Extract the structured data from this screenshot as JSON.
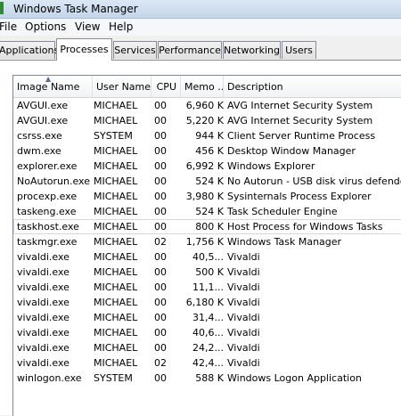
{
  "window": {
    "title": "Windows Task Manager"
  },
  "menu": [
    "File",
    "Options",
    "View",
    "Help"
  ],
  "tabs": [
    "Applications",
    "Processes",
    "Services",
    "Performance",
    "Networking",
    "Users"
  ],
  "active_tab": "Processes",
  "columns": {
    "name": "Image Name",
    "user": "User Name",
    "cpu": "CPU",
    "mem": "Memo ...",
    "desc": "Description",
    "sort_indicator": "▲"
  },
  "processes": [
    {
      "name": "AVGUI.exe",
      "user": "MICHAEL",
      "cpu": "00",
      "mem": "6,960 K",
      "desc": "AVG Internet Security System"
    },
    {
      "name": "AVGUI.exe",
      "user": "MICHAEL",
      "cpu": "00",
      "mem": "5,220 K",
      "desc": "AVG Internet Security System"
    },
    {
      "name": "csrss.exe",
      "user": "SYSTEM",
      "cpu": "00",
      "mem": "944 K",
      "desc": "Client Server Runtime Process"
    },
    {
      "name": "dwm.exe",
      "user": "MICHAEL",
      "cpu": "00",
      "mem": "456 K",
      "desc": "Desktop Window Manager"
    },
    {
      "name": "explorer.exe",
      "user": "MICHAEL",
      "cpu": "00",
      "mem": "6,992 K",
      "desc": "Windows Explorer"
    },
    {
      "name": "NoAutorun.exe",
      "user": "MICHAEL",
      "cpu": "00",
      "mem": "524 K",
      "desc": "No Autorun - USB disk virus defender"
    },
    {
      "name": "procexp.exe",
      "user": "MICHAEL",
      "cpu": "00",
      "mem": "3,980 K",
      "desc": "Sysinternals Process Explorer"
    },
    {
      "name": "taskeng.exe",
      "user": "MICHAEL",
      "cpu": "00",
      "mem": "524 K",
      "desc": "Task Scheduler Engine"
    },
    {
      "name": "taskhost.exe",
      "user": "MICHAEL",
      "cpu": "00",
      "mem": "800 K",
      "desc": "Host Process for Windows Tasks",
      "selected": true
    },
    {
      "name": "taskmgr.exe",
      "user": "MICHAEL",
      "cpu": "02",
      "mem": "1,756 K",
      "desc": "Windows Task Manager"
    },
    {
      "name": "vivaldi.exe",
      "user": "MICHAEL",
      "cpu": "00",
      "mem": "40,5...",
      "desc": "Vivaldi"
    },
    {
      "name": "vivaldi.exe",
      "user": "MICHAEL",
      "cpu": "00",
      "mem": "500 K",
      "desc": "Vivaldi"
    },
    {
      "name": "vivaldi.exe",
      "user": "MICHAEL",
      "cpu": "00",
      "mem": "11,1...",
      "desc": "Vivaldi"
    },
    {
      "name": "vivaldi.exe",
      "user": "MICHAEL",
      "cpu": "00",
      "mem": "6,180 K",
      "desc": "Vivaldi"
    },
    {
      "name": "vivaldi.exe",
      "user": "MICHAEL",
      "cpu": "00",
      "mem": "31,4...",
      "desc": "Vivaldi"
    },
    {
      "name": "vivaldi.exe",
      "user": "MICHAEL",
      "cpu": "00",
      "mem": "40,6...",
      "desc": "Vivaldi"
    },
    {
      "name": "vivaldi.exe",
      "user": "MICHAEL",
      "cpu": "00",
      "mem": "24,2...",
      "desc": "Vivaldi"
    },
    {
      "name": "vivaldi.exe",
      "user": "MICHAEL",
      "cpu": "02",
      "mem": "42,4...",
      "desc": "Vivaldi"
    },
    {
      "name": "winlogon.exe",
      "user": "SYSTEM",
      "cpu": "00",
      "mem": "588 K",
      "desc": "Windows Logon Application"
    }
  ]
}
